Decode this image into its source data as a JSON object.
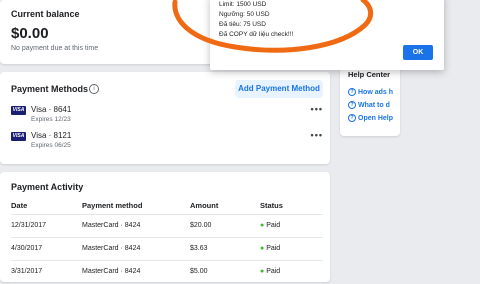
{
  "balance": {
    "title": "Current balance",
    "amount": "$0.00",
    "note": "No payment due at this time"
  },
  "methods": {
    "title": "Payment Methods",
    "add_label": "Add Payment Method",
    "cards": [
      {
        "brand": "VISA",
        "name": "Visa · 8641",
        "expires": "Expires 12/23"
      },
      {
        "brand": "VISA",
        "name": "Visa · 8121",
        "expires": "Expires 06/25"
      }
    ]
  },
  "activity": {
    "title": "Payment Activity",
    "columns": [
      "Date",
      "Payment method",
      "Amount",
      "Status"
    ],
    "rows": [
      {
        "date": "12/31/2017",
        "method": "MasterCard · 8424",
        "amount": "$20.00",
        "status": "Paid"
      },
      {
        "date": "4/30/2017",
        "method": "MasterCard · 8424",
        "amount": "$3.63",
        "status": "Paid"
      },
      {
        "date": "3/31/2017",
        "method": "MasterCard · 8424",
        "amount": "$5.00",
        "status": "Paid"
      }
    ]
  },
  "help": {
    "title": "Help Center",
    "links": [
      "How ads h",
      "What to d",
      "Open Help"
    ]
  },
  "dialog": {
    "lines": [
      "Limit: 1500 USD",
      "Ngưỡng: 50 USD",
      "Đã tiêu: 75 USD",
      "Đã COPY dữ liệu check!!!"
    ],
    "ok_label": "OK"
  },
  "colors": {
    "accent": "#1b74e4",
    "paid": "#42b72a",
    "annotation": "#ef6a12"
  }
}
